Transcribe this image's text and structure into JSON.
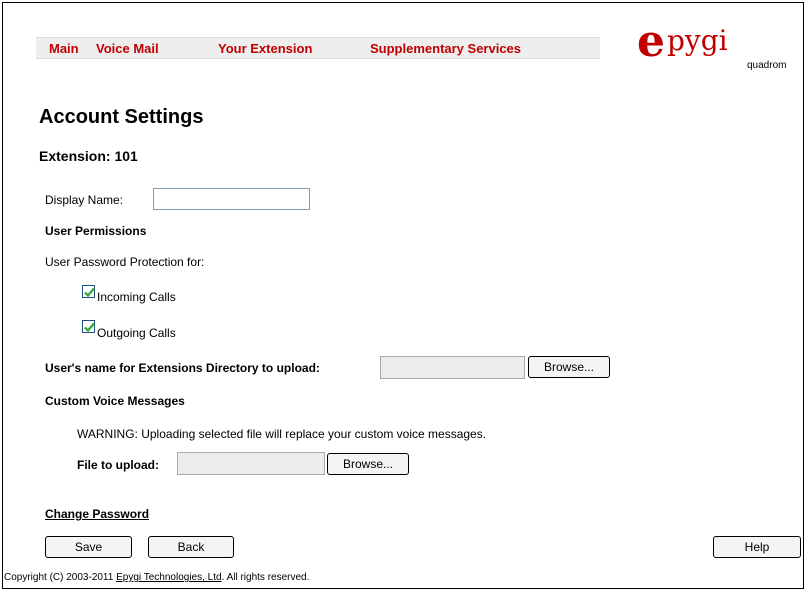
{
  "menu": {
    "items": [
      "Main",
      "Voice Mail",
      "Your Extension",
      "Supplementary Services"
    ]
  },
  "logo": {
    "mark": "e",
    "text": "pygi",
    "sub": "quadrom"
  },
  "page": {
    "title": "Account Settings",
    "extension": "Extension: 101"
  },
  "form": {
    "display_name_label": "Display Name:",
    "display_name_value": "",
    "user_permissions_heading": "User Permissions",
    "password_protection_label": "User Password Protection for:",
    "incoming_calls_label": "Incoming Calls",
    "incoming_calls_checked": true,
    "outgoing_calls_label": "Outgoing Calls",
    "outgoing_calls_checked": true,
    "directory_upload_label": "User's name for Extensions Directory to upload:",
    "browse_label": "Browse...",
    "custom_voice_heading": "Custom Voice Messages",
    "warning_text": "WARNING: Uploading selected file will replace your custom voice messages.",
    "file_upload_label": "File to upload:"
  },
  "links": {
    "change_password": "Change Password"
  },
  "buttons": {
    "save": "Save",
    "back": "Back",
    "help": "Help"
  },
  "footer": {
    "prefix": "Copyright (C) 2003-2011 ",
    "company": "Epygi Technologies, Ltd",
    "suffix": ". All rights reserved."
  },
  "colors": {
    "accent": "#c00000",
    "menu_bg": "#eeeeee",
    "check": "#2ea82e"
  }
}
